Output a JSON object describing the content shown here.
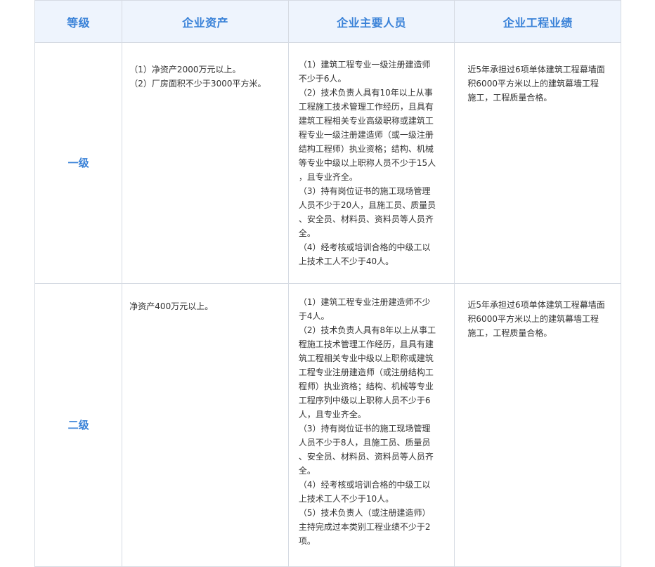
{
  "header": {
    "level": "等级",
    "assets": "企业资产",
    "staff": "企业主要人员",
    "performance": "企业工程业绩"
  },
  "rows": [
    {
      "level": "一级",
      "assets": "（1）净资产2000万元以上。\n（2）厂房面积不少于3000平方米。",
      "staff": "（1）建筑工程专业一级注册建造师\n不少于6人。\n（2）技术负责人具有10年以上从事\n工程施工技术管理工作经历，且具有\n建筑工程相关专业高级职称或建筑工\n程专业一级注册建造师（或一级注册\n结构工程师）执业资格；结构、机械\n等专业中级以上职称人员不少于15人\n，且专业齐全。\n（3）持有岗位证书的施工现场管理\n人员不少于20人，且施工员、质量员\n、安全员、材料员、资料员等人员齐\n全。\n（4）经考核或培训合格的中级工以\n上技术工人不少于40人。",
      "performance": "近5年承担过6项单体建筑工程幕墙面\n积6000平方米以上的建筑幕墙工程\n施工，工程质量合格。"
    },
    {
      "level": "二级",
      "assets": "净资产400万元以上。",
      "staff": "（1）建筑工程专业注册建造师不少\n于4人。\n（2）技术负责人具有8年以上从事工\n程施工技术管理工作经历，且具有建\n筑工程相关专业中级以上职称或建筑\n工程专业注册建造师（或注册结构工\n程师）执业资格；结构、机械等专业\n工程序列中级以上职称人员不少于6\n人，且专业齐全。\n（3）持有岗位证书的施工现场管理\n人员不少于8人，且施工员、质量员\n、安全员、材料员、资料员等人员齐\n全。\n（4）经考核或培训合格的中级工以\n上技术工人不少于10人。\n（5）技术负责人（或注册建造师）\n主持完成过本类别工程业绩不少于2\n项。",
      "performance": "近5年承担过6项单体建筑工程幕墙面\n积6000平方米以上的建筑幕墙工程\n施工，工程质量合格。"
    }
  ],
  "colors": {
    "header_bg": "#eef4fd",
    "accent": "#3a82d8",
    "border": "#d6dbe3",
    "text": "#333333"
  }
}
